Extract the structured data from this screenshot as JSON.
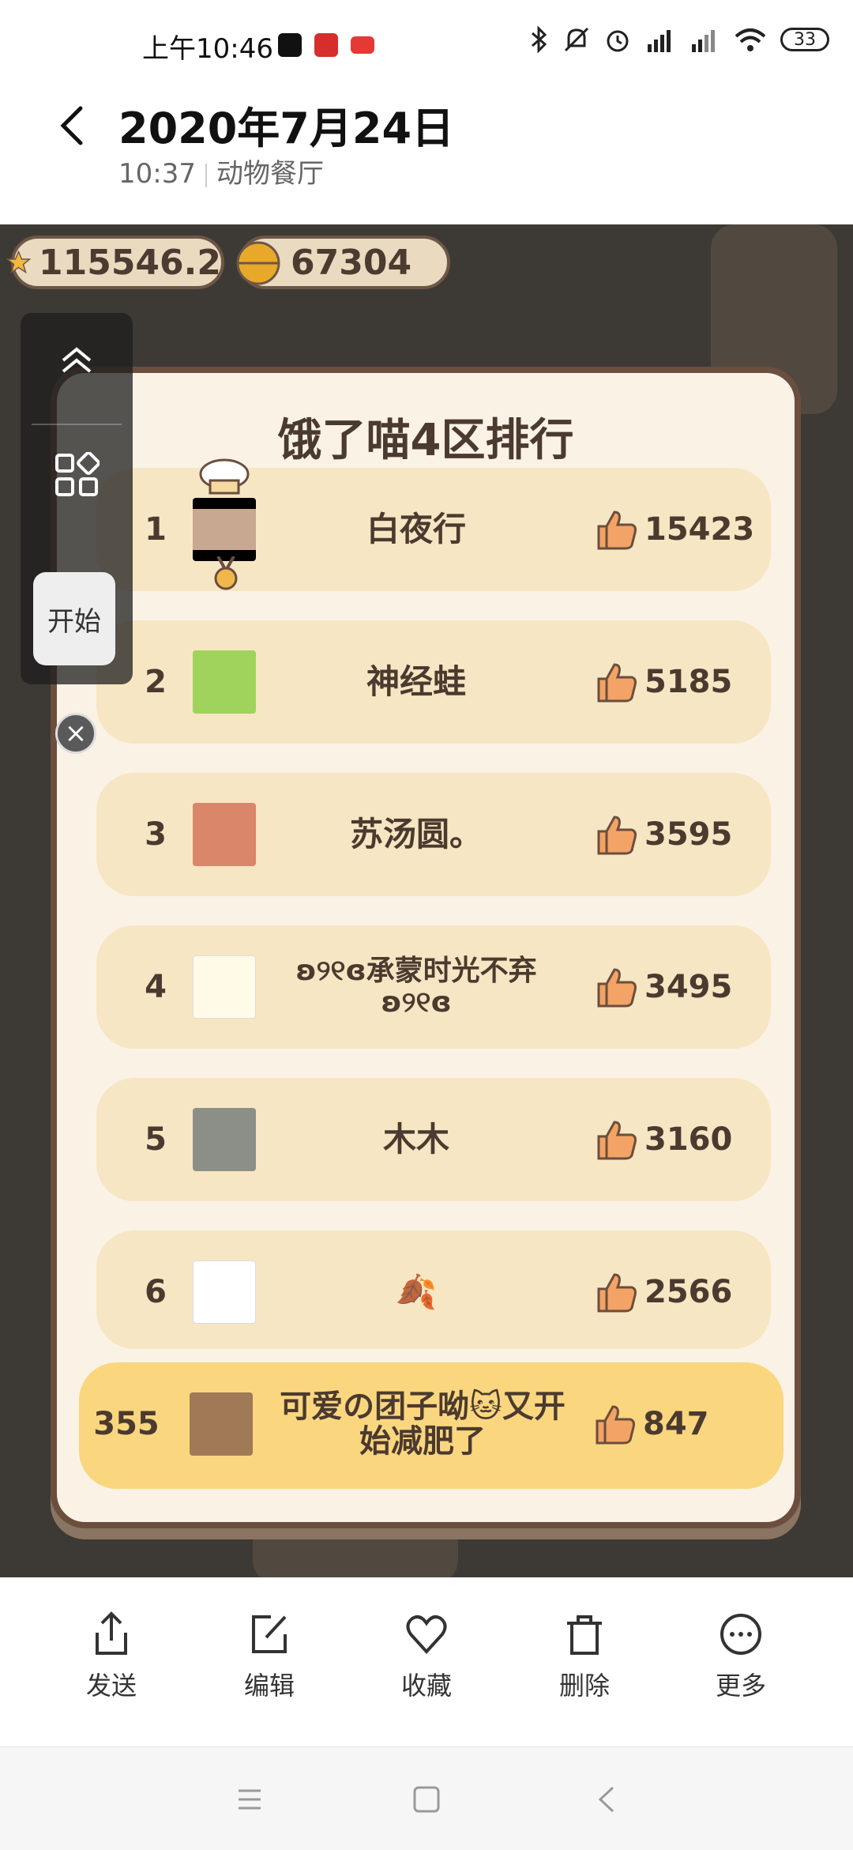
{
  "status_bar": {
    "time": "上午10:46",
    "battery": "33",
    "app_icons": [
      "tiktok-icon",
      "news-app-icon",
      "toutiao-icon"
    ]
  },
  "header": {
    "title": "2020年7月24日",
    "time": "10:37",
    "location": "动物餐厅"
  },
  "game": {
    "stars": "115546.2",
    "bells": "67304",
    "side_start": "开始",
    "board_title": "饿了喵4区排行",
    "rows": [
      {
        "rank": "1",
        "name": "白夜行",
        "score": "15423"
      },
      {
        "rank": "2",
        "name": "神经蛙",
        "score": "5185"
      },
      {
        "rank": "3",
        "name": "苏汤圆。",
        "score": "3595"
      },
      {
        "rank": "4",
        "name": "ʚ୨୧ɞ承蒙时光不弃ʚ୨୧ɞ",
        "score": "3495"
      },
      {
        "rank": "5",
        "name": "木木",
        "score": "3160"
      },
      {
        "rank": "6",
        "name": "🍂",
        "score": "2566"
      }
    ],
    "me": {
      "rank": "355",
      "name": "可爱の团子呦🐱又开始减肥了",
      "score": "847"
    },
    "colors": {
      "board": "#fbf2e6",
      "row": "#f6e6c3",
      "me_row": "#fad67f",
      "border": "#6b4e3e"
    }
  },
  "actions": [
    {
      "label": "发送",
      "icon": "share-icon"
    },
    {
      "label": "编辑",
      "icon": "edit-icon"
    },
    {
      "label": "收藏",
      "icon": "heart-icon"
    },
    {
      "label": "删除",
      "icon": "trash-icon"
    },
    {
      "label": "更多",
      "icon": "more-icon"
    }
  ]
}
